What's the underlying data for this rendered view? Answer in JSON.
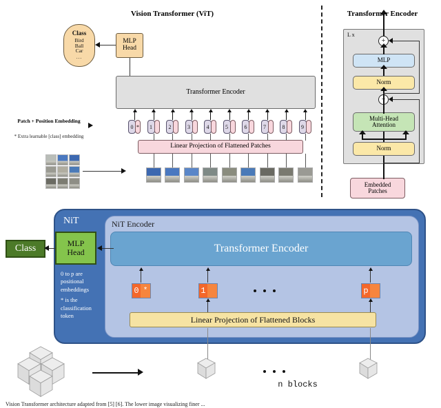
{
  "figure": {
    "vit_title": "Vision Transformer (ViT)",
    "encoder_title": "Transformer Encoder"
  },
  "vit": {
    "class_head": "Class",
    "class_items": [
      "Bird",
      "Ball",
      "Car"
    ],
    "class_ellipsis": "...",
    "mlp_head_line1": "MLP",
    "mlp_head_line2": "Head",
    "encoder_label": "Transformer Encoder",
    "linear_projection": "Linear Projection of Flattened Patches",
    "patch_pos_label": "Patch + Position Embedding",
    "extra_learnable_label": "* Extra learnable [class] embedding",
    "tokens": [
      {
        "num": "0",
        "star": "*"
      },
      {
        "num": "1",
        "star": ""
      },
      {
        "num": "2",
        "star": ""
      },
      {
        "num": "3",
        "star": ""
      },
      {
        "num": "4",
        "star": ""
      },
      {
        "num": "5",
        "star": ""
      },
      {
        "num": "6",
        "star": ""
      },
      {
        "num": "7",
        "star": ""
      },
      {
        "num": "8",
        "star": ""
      },
      {
        "num": "9",
        "star": ""
      }
    ]
  },
  "encoder_detail": {
    "repeat_label": "L x",
    "plus_symbol": "+",
    "mlp": "MLP",
    "norm_top": "Norm",
    "mha_line1": "Multi-Head",
    "mha_line2": "Attention",
    "norm_bottom": "Norm",
    "embedded_line1": "Embedded",
    "embedded_line2": "Patches"
  },
  "nit": {
    "outer_label": "NiT",
    "inner_label": "NiT Encoder",
    "class_label": "Class",
    "mlp_head_line1": "MLP",
    "mlp_head_line2": "Head",
    "transformer_encoder": "Transformer Encoder",
    "linear_projection": "Linear Projection of Flattened Blocks",
    "side_note_1": "0 to p are positional embeddings",
    "side_note_2": "* is the classification token",
    "tokens": [
      {
        "num": "0",
        "star": "*"
      },
      {
        "num": "1",
        "star": ""
      },
      {
        "num": "p",
        "star": ""
      }
    ],
    "n_blocks_label": "n blocks"
  },
  "colors": {
    "nit_outer": "#4472b4",
    "nit_inner": "#b4c4e4",
    "nit_transformer": "#6aa4d0",
    "mlp_head_green": "#84c44c",
    "class_green": "#4c7a28",
    "token_orange_dark": "#f4672a",
    "token_orange_light": "#f6853d",
    "linear_projection_yellow": "#f6e3a3",
    "vit_peach": "#f8d9a8",
    "vit_pink": "#f8d7dd",
    "vit_grey": "#e0e0e0",
    "enc_mlp_blue": "#cfe4f5",
    "enc_norm_yellow": "#fbe8a8",
    "enc_mha_green": "#c5e5b6"
  },
  "caption": {
    "text": "Vision Transformer architecture adapted from [5] [6]. The lower image visualizing finer ..."
  }
}
